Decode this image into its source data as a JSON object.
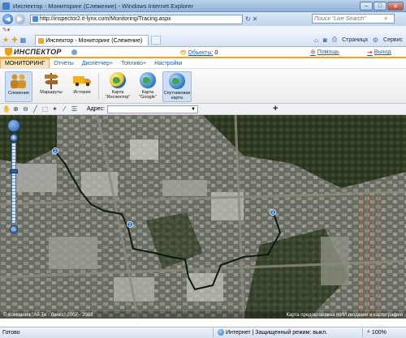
{
  "browser": {
    "title": "Инспектор - Мониторинг (Слежение) - Windows Internet Explorer",
    "url": "http://inspector2.it-lynx.com/Monitoring/Tracing.aspx",
    "search_placeholder": "Поиск \"Live Search\"",
    "tab_label": "Инспектор - Мониторинг (Слежение)",
    "tools": {
      "page": "Страница",
      "service": "Сервис"
    },
    "status_left": "Готово",
    "status_zone": "Интернет | Защищенный режим: выкл.",
    "status_zoom": "100%"
  },
  "app": {
    "logo_text": "ИНСПЕКТОР",
    "objects_label": "Объекты:",
    "objects_count": "0",
    "help_label": "Помощь",
    "logout_label": "Выход",
    "nav": [
      "МОНИТОРИНГ",
      "Отчёты",
      "Диспетчер+",
      "Топливо+",
      "Настройки"
    ],
    "ribbon": [
      {
        "label": "Слежение",
        "icon": "people-icon",
        "active": true
      },
      {
        "label": "Маршруты",
        "icon": "signpost-icon",
        "active": false
      },
      {
        "label": "История",
        "icon": "truck-icon",
        "active": false
      },
      {
        "label": "Карта \"Инспектор\"",
        "icon": "globe-icon",
        "active": false
      },
      {
        "label": "Карта \"Google\"",
        "icon": "globe-icon",
        "active": false
      },
      {
        "label": "Спутниковая карта",
        "icon": "globe-icon",
        "active": true
      }
    ],
    "map_toolbar": {
      "address_label": "Адрес:"
    },
    "map_footer": {
      "copyright": "© Компания \"Ай Ти - Линкс\" 2007 - 2008",
      "provider": "Карта предоставлена НИИ геодезии и картографии"
    },
    "route_markers": [
      "1",
      "2",
      "3"
    ]
  },
  "colors": {
    "accent": "#f0a21c",
    "link": "#1a5fb4",
    "route": "#0b1a10"
  }
}
